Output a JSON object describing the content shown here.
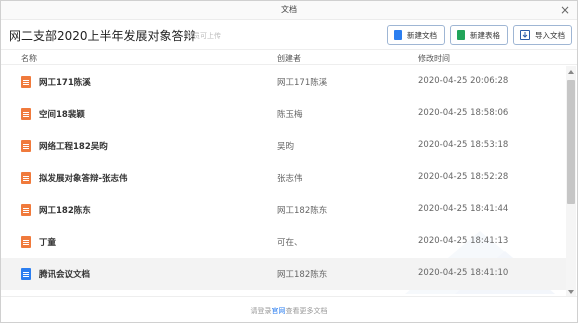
{
  "window": {
    "title": "文档",
    "close_glyph": "×"
  },
  "header": {
    "group_title": "网二支部2020上半年发展对象答辩",
    "subtitle": "全员可上传"
  },
  "toolbar": {
    "new_doc_label": "新建文档",
    "new_sheet_label": "新建表格",
    "import_label": "导入文档"
  },
  "columns": {
    "name": "名称",
    "creator": "创建者",
    "modified": "修改时间"
  },
  "files": [
    {
      "name": "网工171陈溪",
      "creator": "网工171陈溪",
      "modified": "2020-04-25 20:06:28",
      "icon": "ppt-file-icon"
    },
    {
      "name": "空间18裴颖",
      "creator": "陈玉梅",
      "modified": "2020-04-25 18:58:06",
      "icon": "ppt-file-icon"
    },
    {
      "name": "网络工程182吴昀",
      "creator": "吴昀",
      "modified": "2020-04-25 18:53:18",
      "icon": "ppt-file-icon"
    },
    {
      "name": "拟发展对象答辩-张志伟",
      "creator": "张志伟",
      "modified": "2020-04-25 18:52:28",
      "icon": "ppt-file-icon"
    },
    {
      "name": "网工182陈东",
      "creator": "网工182陈东",
      "modified": "2020-04-25 18:41:44",
      "icon": "ppt-file-icon"
    },
    {
      "name": "丁童",
      "creator": "可在、",
      "modified": "2020-04-25 18:41:13",
      "icon": "ppt-file-icon"
    },
    {
      "name": "腾讯会议文档",
      "creator": "网工182陈东",
      "modified": "2020-04-25 18:41:10",
      "icon": "doc-file-icon"
    }
  ],
  "footer": {
    "prefix": "请登录",
    "link": "官网",
    "suffix": "查看更多文档"
  },
  "colors": {
    "ppt_icon": "#f07a3c",
    "doc_icon": "#2b7ef0",
    "sheet_icon": "#21a55a",
    "button_border": "#9fb6d4"
  }
}
